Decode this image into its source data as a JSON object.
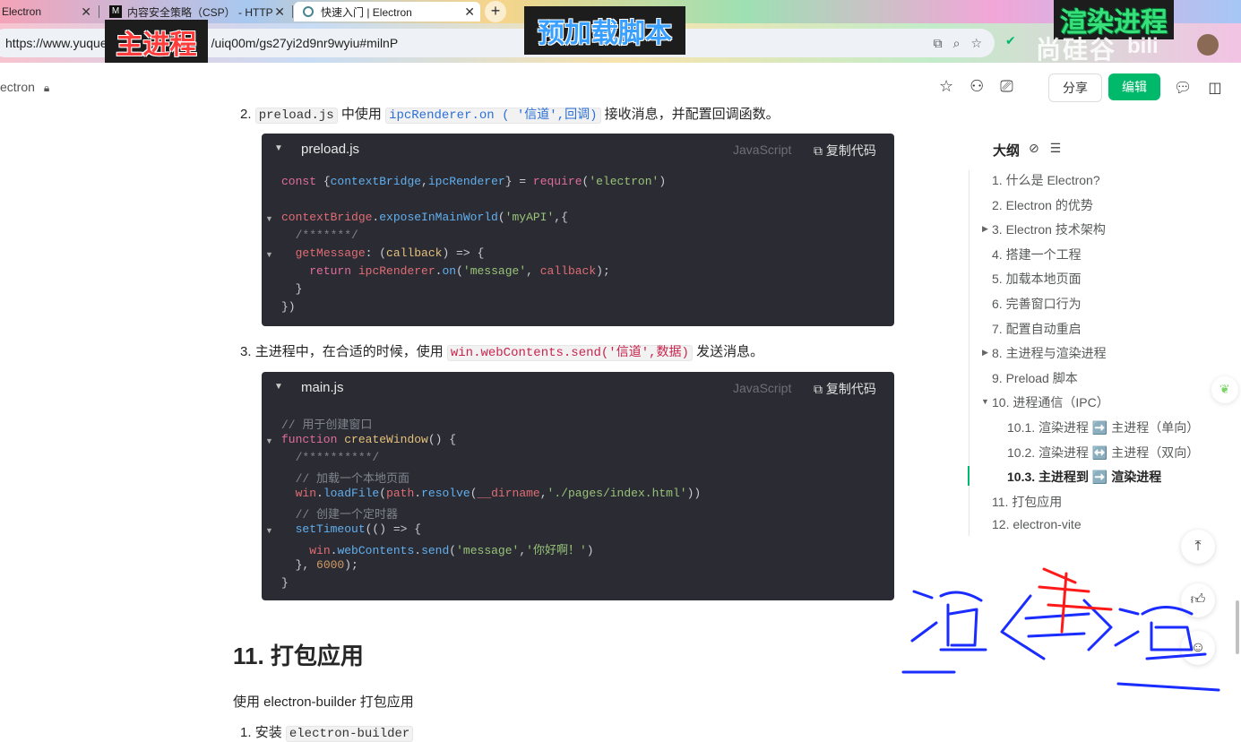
{
  "browser": {
    "tabs": [
      {
        "title": "Electron",
        "active": false
      },
      {
        "title": "内容安全策略（CSP） - HTTP",
        "active": false
      },
      {
        "title": "快速入门 | Electron",
        "active": true
      }
    ],
    "new_tab_label": "+",
    "url": "https://www.yuque.com/tianyu-coder/uiq00m/gs27yi2d9nr9wyiu#milnP",
    "url_visible": "https://www.yuque",
    "url_visible_tail": "/uiq00m/gs27yi2d9nr9wyiu#milnP"
  },
  "overlays": {
    "main_process": "主进程",
    "preload_script": "预加载脚本",
    "render_process": "渲染进程",
    "watermark": "尚硅谷",
    "bilibili": "bili"
  },
  "header": {
    "breadcrumb": "ectron",
    "share_label": "分享",
    "edit_label": "编辑"
  },
  "article": {
    "item2_num": "2.",
    "item2_code1": "preload.js",
    "item2_text1": "中使用",
    "item2_code2": "ipcRenderer.on ( '信道',回调)",
    "item2_text2": "接收消息，并配置回调函数。",
    "code1": {
      "filename": "preload.js",
      "lang": "JavaScript",
      "copy": "复制代码"
    },
    "item3_num": "3.",
    "item3_text1": "主进程中，在合适的时候，使用",
    "item3_code": "win.webContents.send('信道',数据)",
    "item3_text2": "发送消息。",
    "code2": {
      "filename": "main.js",
      "lang": "JavaScript",
      "copy": "复制代码"
    },
    "h2": "11. 打包应用",
    "para": "使用 electron-builder  打包应用",
    "item1_num": "1.",
    "item1_text": "安装",
    "item1_code": "electron-builder"
  },
  "outline": {
    "title": "大纲",
    "items": [
      {
        "label": "1. 什么是 Electron?"
      },
      {
        "label": "2. Electron 的优势"
      },
      {
        "label": "3. Electron 技术架构"
      },
      {
        "label": "4. 搭建一个工程"
      },
      {
        "label": "5. 加载本地页面"
      },
      {
        "label": "6. 完善窗口行为"
      },
      {
        "label": "7. 配置自动重启"
      },
      {
        "label": "8. 主进程与渲染进程"
      },
      {
        "label": "9. Preload 脚本"
      },
      {
        "label": "10. 进程通信（IPC）"
      },
      {
        "label": "10.1. 渲染进程 ➡️ 主进程（单向）"
      },
      {
        "label": "10.2. 渲染进程 ↔️ 主进程（双向）"
      },
      {
        "label": "10.3. 主进程到 ➡️ 渲染进程"
      },
      {
        "label": "11. 打包应用"
      },
      {
        "label": "12. electron-vite"
      }
    ]
  },
  "colors": {
    "accent": "#00b96b",
    "code_bg": "#2b2c33",
    "ink_blue": "#1a2cff",
    "ink_red": "#ff1a1a"
  }
}
